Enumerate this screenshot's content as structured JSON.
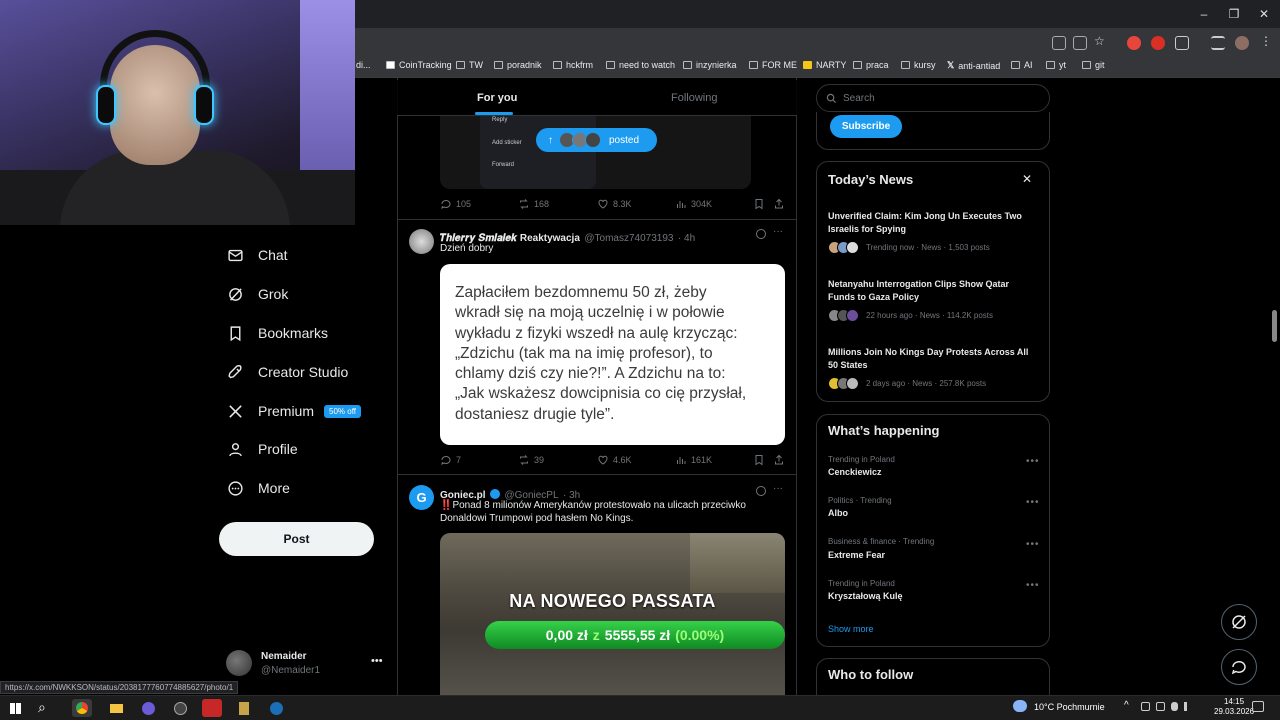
{
  "browser": {
    "bookmarks": [
      "di...",
      "CoinTracking",
      "TW",
      "poradnik",
      "hckfrm",
      "need to watch",
      "inzynierka",
      "FOR ME",
      "NARTY",
      "praca",
      "kursy",
      "anti-antiad",
      "AI",
      "yt",
      "git"
    ],
    "status_url": "https://x.com/NWKKSON/status/2038177760774885627/photo/1"
  },
  "nav": {
    "items": [
      {
        "label": "Chat"
      },
      {
        "label": "Grok"
      },
      {
        "label": "Bookmarks"
      },
      {
        "label": "Creator Studio"
      },
      {
        "label": "Premium"
      },
      {
        "label": "Profile"
      },
      {
        "label": "More"
      }
    ],
    "premium_badge": "50% off",
    "post_label": "Post",
    "account": {
      "name": "Nemaider",
      "handle": "@Nemaider1"
    }
  },
  "feed": {
    "tabs": {
      "for_you": "For you",
      "following": "Following"
    },
    "posted_pill": "posted",
    "menu_labels": [
      "Reply",
      "Add sticker",
      "Forward"
    ],
    "tweet0": {
      "replies": "105",
      "retweets": "168",
      "likes": "8.3K",
      "views": "304K"
    },
    "tweet1": {
      "name": "𝑻𝒉𝒊𝒆𝒓𝒓𝒚 𝑺𝒎𝒊𝒂𝒍𝒆𝒌 Reaktywacja",
      "handle": "@Tomasz74073193",
      "time": "· 4h",
      "text": "Dzień dobry",
      "image_text": [
        "Zapłaciłem bezdomnemu 50 zł, żeby",
        "wkradł się na moją uczelnię i w połowie",
        "wykładu z fizyki wszedł na aulę krzycząc:",
        "„Zdzichu (tak ma na imię profesor), to",
        "chlamy dziś czy nie?!”. A Zdzichu na to:",
        "„Jak wskażesz dowcipnisia co cię przysłał,",
        "dostaniesz drugie tyle”."
      ],
      "replies": "7",
      "retweets": "39",
      "likes": "4.6K",
      "views": "161K"
    },
    "tweet2": {
      "name": "Goniec.pl",
      "handle": "@GoniecPL",
      "time": "· 3h",
      "text_line1": "‼️Ponad 8 milionów Amerykanów protestowało na ulicach przeciwko",
      "text_line2": "Donaldowi Trumpowi pod hasłem No Kings.",
      "image_title": "NA NOWEGO PASSATA",
      "image_bar_a": "0,00 zł",
      "image_bar_z": "z",
      "image_bar_b": "5555,55 zł",
      "image_bar_pct": "(0.00%)"
    }
  },
  "right": {
    "search_placeholder": "Search",
    "subscribe": "Subscribe",
    "news_title": "Today’s News",
    "news": [
      {
        "title": "Unverified Claim: Kim Jong Un Executes Two Israelis for Spying",
        "meta": "Trending now · News · 1,503 posts"
      },
      {
        "title": "Netanyahu Interrogation Clips Show Qatar Funds to Gaza Policy",
        "meta": "22 hours ago · News · 114.2K posts"
      },
      {
        "title": "Millions Join No Kings Day Protests Across All 50 States",
        "meta": "2 days ago · News · 257.8K posts"
      }
    ],
    "happening_title": "What’s happening",
    "trends": [
      {
        "meta": "Trending in Poland",
        "title": "Cenckiewicz"
      },
      {
        "meta": "Politics · Trending",
        "title": "Albo"
      },
      {
        "meta": "Business & finance · Trending",
        "title": "Extreme Fear"
      },
      {
        "meta": "Trending in Poland",
        "title": "Kryształową Kulę"
      }
    ],
    "show_more": "Show more",
    "who_to_follow": "Who to follow"
  },
  "taskbar": {
    "weather": "10°C",
    "weather_desc": "Pochmurnie",
    "time": "14:15",
    "date": "29.03.2026"
  }
}
